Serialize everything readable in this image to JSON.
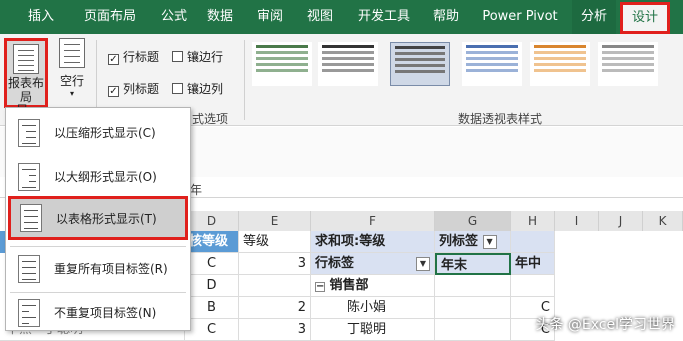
{
  "tabs": [
    "插入",
    "页面布局",
    "公式",
    "数据",
    "审阅",
    "视图",
    "开发工具",
    "帮助",
    "Power Pivot",
    "分析",
    "设计"
  ],
  "ribbon": {
    "report_layout_label": "报表布局",
    "report_layout_label2": "局",
    "blank_rows_label": "空行",
    "row_headers": "行标题",
    "col_headers": "列标题",
    "banded_rows": "镶边行",
    "banded_cols": "镶边列",
    "style_options_group": "式选项",
    "pivot_styles_group": "数据透视表样式",
    "left_group_frag": "局"
  },
  "formula_frag": "年",
  "dropdown": [
    {
      "label": "以压缩形式显示(C)"
    },
    {
      "label": "以大纲形式显示(O)"
    },
    {
      "label": "以表格形式显示(T)"
    },
    {
      "label": "重复所有项目标签(R)"
    },
    {
      "label": "不重复项目标签(N)"
    }
  ],
  "columns": [
    "D",
    "E",
    "F",
    "G",
    "H",
    "I",
    "J",
    "K"
  ],
  "grid": {
    "d_header": "核等级",
    "e_header": "等级",
    "d_vals": [
      "C",
      "D",
      "B",
      "C"
    ],
    "e_vals": [
      "3",
      "",
      "2",
      "3"
    ],
    "a_frag": "干黑",
    "b_frag": "丁聪明",
    "pivot_sum": "求和项:等级",
    "pivot_col": "列标签",
    "pivot_row": "行标签",
    "pivot_year_end": "年末",
    "pivot_mid": "年中",
    "dept": "销售部",
    "emp1": "陈小娟",
    "emp2": "丁聪明",
    "h_val": "C",
    "h_val2": "C"
  },
  "watermark": "头条 @Excel学习世界"
}
